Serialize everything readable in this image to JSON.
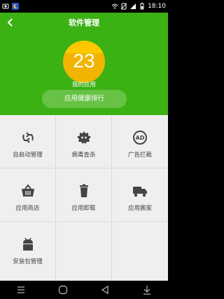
{
  "status": {
    "time": "18:10",
    "icons": [
      "screenshot-icon",
      "moon-icon",
      "wifi-icon",
      "no-sim-icon",
      "signal-icon",
      "battery-icon"
    ]
  },
  "header": {
    "title": "软件管理",
    "score": "23",
    "score_label": "我的应用",
    "rank_button": "应用健康排行"
  },
  "grid": [
    {
      "label": "自启动管理",
      "icon": "autostart-icon"
    },
    {
      "label": "病毒查杀",
      "icon": "virus-icon"
    },
    {
      "label": "广告拦截",
      "icon": "ad-block-icon"
    },
    {
      "label": "应用商店",
      "icon": "store-basket-icon"
    },
    {
      "label": "应用卸载",
      "icon": "trash-icon"
    },
    {
      "label": "应用搬家",
      "icon": "truck-icon"
    },
    {
      "label": "安装包管理",
      "icon": "android-icon"
    }
  ],
  "colors": {
    "header_green": "#3cb114",
    "score_yellow": "#ffc800",
    "button_green": "#67c245",
    "icon_gray": "#444444"
  }
}
